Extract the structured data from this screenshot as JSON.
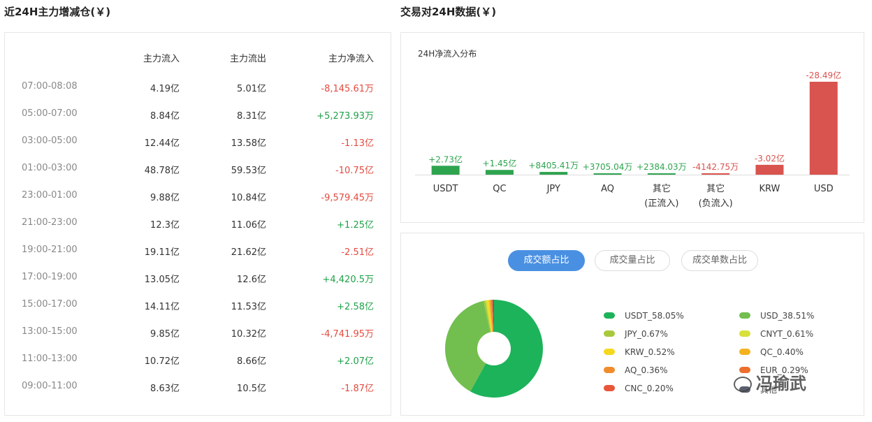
{
  "left_title": "近24H主力增减仓(￥)",
  "right_title": "交易对24H数据(￥)",
  "flow_table": {
    "headers": {
      "time": "",
      "inflow": "主力流入",
      "outflow": "主力流出",
      "net": "主力净流入"
    },
    "rows": [
      {
        "time": "07:00-08:08",
        "inflow": "4.19亿",
        "outflow": "5.01亿",
        "net": "-8,145.61万",
        "sign": "neg"
      },
      {
        "time": "05:00-07:00",
        "inflow": "8.84亿",
        "outflow": "8.31亿",
        "net": "+5,273.93万",
        "sign": "pos"
      },
      {
        "time": "03:00-05:00",
        "inflow": "12.44亿",
        "outflow": "13.58亿",
        "net": "-1.13亿",
        "sign": "neg"
      },
      {
        "time": "01:00-03:00",
        "inflow": "48.78亿",
        "outflow": "59.53亿",
        "net": "-10.75亿",
        "sign": "neg"
      },
      {
        "time": "23:00-01:00",
        "inflow": "9.88亿",
        "outflow": "10.84亿",
        "net": "-9,579.45万",
        "sign": "neg"
      },
      {
        "time": "21:00-23:00",
        "inflow": "12.3亿",
        "outflow": "11.06亿",
        "net": "+1.25亿",
        "sign": "pos"
      },
      {
        "time": "19:00-21:00",
        "inflow": "19.11亿",
        "outflow": "21.62亿",
        "net": "-2.51亿",
        "sign": "neg"
      },
      {
        "time": "17:00-19:00",
        "inflow": "13.05亿",
        "outflow": "12.6亿",
        "net": "+4,420.5万",
        "sign": "pos"
      },
      {
        "time": "15:00-17:00",
        "inflow": "14.11亿",
        "outflow": "11.53亿",
        "net": "+2.58亿",
        "sign": "pos"
      },
      {
        "time": "13:00-15:00",
        "inflow": "9.85亿",
        "outflow": "10.32亿",
        "net": "-4,741.95万",
        "sign": "neg"
      },
      {
        "time": "11:00-13:00",
        "inflow": "10.72亿",
        "outflow": "8.66亿",
        "net": "+2.07亿",
        "sign": "pos"
      },
      {
        "time": "09:00-11:00",
        "inflow": "8.63亿",
        "outflow": "10.5亿",
        "net": "-1.87亿",
        "sign": "neg"
      }
    ]
  },
  "chart_data": [
    {
      "type": "bar",
      "title": "24H净流入分布",
      "categories": [
        "USDT",
        "QC",
        "JPY",
        "AQ",
        "其它\n(正流入)",
        "其它\n(负流入)",
        "KRW",
        "USD"
      ],
      "values": [
        273000000,
        145000000,
        84054100,
        37050400,
        23840300,
        -41427500,
        -302000000,
        -2849000000
      ],
      "value_labels": [
        "+2.73亿",
        "+1.45亿",
        "+8405.41万",
        "+3705.04万",
        "+2384.03万",
        "-4142.75万",
        "-3.02亿",
        "-28.49亿"
      ],
      "colors": {
        "positive": "#2ea44f",
        "negative": "#d9534f"
      },
      "plot": "magnitude bars, colour encodes sign"
    },
    {
      "type": "pie",
      "donut": true,
      "labels": [
        "USDT_58.05%",
        "USD_38.51%",
        "JPY_0.67%",
        "CNYT_0.61%",
        "KRW_0.52%",
        "QC_0.40%",
        "AQ_0.36%",
        "EUR_0.29%",
        "CNC_0.20%",
        "其他"
      ],
      "values": [
        58.05,
        38.51,
        0.67,
        0.61,
        0.52,
        0.4,
        0.36,
        0.29,
        0.2,
        0.39
      ],
      "colors": [
        "#1db35a",
        "#72bf4f",
        "#a9c93c",
        "#d8e03a",
        "#f5d81e",
        "#f4b21f",
        "#f08c2a",
        "#ec6f2e",
        "#e8573a",
        "#5a5f6e"
      ]
    }
  ],
  "pie_tabs": [
    "成交额占比",
    "成交量占比",
    "成交单数占比"
  ],
  "watermark": "冯瑜武"
}
